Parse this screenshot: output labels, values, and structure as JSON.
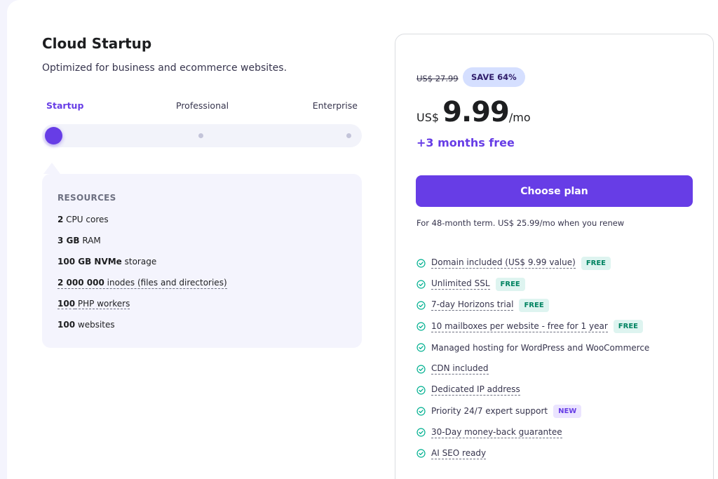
{
  "plan": {
    "title": "Cloud Startup",
    "subtitle": "Optimized for business and ecommerce websites."
  },
  "tiers": [
    "Startup",
    "Professional",
    "Enterprise"
  ],
  "selected_tier_index": 0,
  "resources": {
    "heading": "RESOURCES",
    "items": [
      {
        "bold": "2",
        "text": " CPU cores"
      },
      {
        "bold": "3 GB",
        "text": " RAM"
      },
      {
        "bold": "100 GB NVMe",
        "text": " storage"
      },
      {
        "bold": "2 000 000",
        "text": " inodes (files and directories)"
      },
      {
        "bold": "100",
        "text": " PHP workers"
      },
      {
        "bold": "100",
        "text": " websites"
      }
    ]
  },
  "pricing": {
    "old_price": "US$ 27.99",
    "save_badge": "SAVE 64%",
    "currency": "US$",
    "amount": "9.99",
    "period": "/mo",
    "bonus": "+3 months free",
    "button_label": "Choose plan",
    "term_note": "For 48-month term. US$ 25.99/mo when you renew"
  },
  "features": [
    {
      "text": "Domain included (US$ 9.99 value)",
      "badge": "FREE",
      "badge_type": "free"
    },
    {
      "text": "Unlimited SSL",
      "badge": "FREE",
      "badge_type": "free"
    },
    {
      "text": "7-day Horizons trial",
      "badge": "FREE",
      "badge_type": "free"
    },
    {
      "text": "10 mailboxes per website - free for 1 year",
      "badge": "FREE",
      "badge_type": "free"
    },
    {
      "text": "Managed hosting for WordPress and WooCommerce",
      "badge": "",
      "badge_type": ""
    },
    {
      "text": "CDN included",
      "badge": "",
      "badge_type": ""
    },
    {
      "text": "Dedicated IP address",
      "badge": "",
      "badge_type": ""
    },
    {
      "text": "Priority 24/7 expert support",
      "badge": "NEW",
      "badge_type": "new"
    },
    {
      "text": "30-Day money-back guarantee",
      "badge": "",
      "badge_type": ""
    },
    {
      "text": "AI SEO ready",
      "badge": "",
      "badge_type": ""
    }
  ],
  "icons": {
    "feature_check": "check-circle-icon"
  },
  "colors": {
    "accent": "#673de6",
    "free_badge_bg": "#def4f0",
    "free_badge_text": "#008361",
    "new_badge_bg": "#ebe4ff",
    "save_badge_bg": "#d5dfff"
  }
}
